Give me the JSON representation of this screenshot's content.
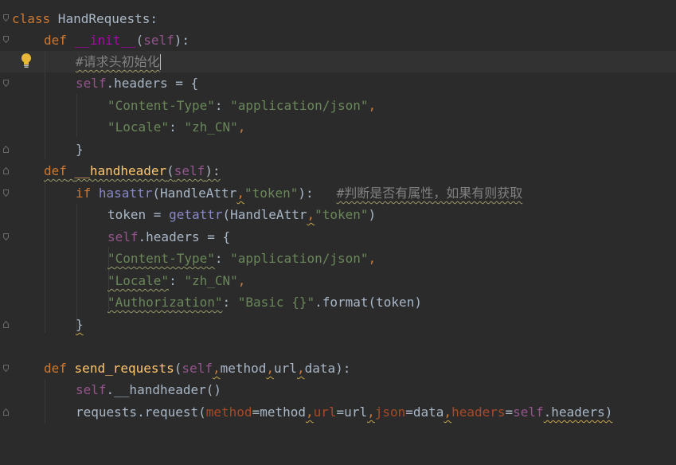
{
  "editor": {
    "lines": {
      "l1": {
        "kw": "class",
        "name": " HandRequests:"
      },
      "l2": {
        "kw": "def",
        "fn": "__init__",
        "open": "(",
        "self": "self",
        "close": "):"
      },
      "l3": {
        "comment": "#请求头初始化"
      },
      "l4": {
        "self": "self",
        "rest": ".headers = {"
      },
      "l5": {
        "key": "\"Content-Type\"",
        "colon": ": ",
        "val": "\"application/json\"",
        "comma": ","
      },
      "l6": {
        "key": "\"Locale\"",
        "colon": ": ",
        "val": "\"zh_CN\"",
        "comma": ","
      },
      "l7": {
        "brace": "}"
      },
      "l8": {
        "kw": "def",
        "fn": "__handheader",
        "open": "(",
        "self": "self",
        "close": "):"
      },
      "l9": {
        "kw": "if",
        "builtin": "hasattr",
        "open": "(HandleAttr",
        "comma": ",",
        "str": "\"token\"",
        "close": "):",
        "comment": "#判断是否有属性，如果有则获取"
      },
      "l10": {
        "pre": "token = ",
        "builtin": "getattr",
        "open": "(HandleAttr",
        "comma": ",",
        "str": "\"token\"",
        "close": ")"
      },
      "l11": {
        "self": "self",
        "rest": ".headers = {"
      },
      "l12": {
        "key": "\"Content-Type\"",
        "colon": ": ",
        "val": "\"application/json\"",
        "comma": ","
      },
      "l13": {
        "key": "\"Locale\"",
        "colon": ": ",
        "val": "\"zh_CN\"",
        "comma": ","
      },
      "l14": {
        "key": "\"Authorization\"",
        "colon": ": ",
        "val": "\"Basic {}\"",
        "rest": ".format(token)"
      },
      "l15": {
        "brace": "}"
      },
      "l17": {
        "kw": "def",
        "fn": "send_requests",
        "open": "(",
        "self": "self",
        "comma1": ",",
        "p1": "method",
        "comma2": ",",
        "p2": "url",
        "comma3": ",",
        "p3": "data",
        "close": "):"
      },
      "l18": {
        "self": "self",
        "rest": ".__handheader()"
      },
      "l19": {
        "pre": "requests.request(",
        "k1": "method",
        "eq1": "=method",
        "c1": ",",
        "k2": "url",
        "eq2": "=url",
        "c2": ",",
        "k3": "json",
        "eq3": "=data",
        "c3": ",",
        "k4": "headers",
        "eq4": "=",
        "self": "self",
        "rest": ".headers)"
      }
    }
  }
}
